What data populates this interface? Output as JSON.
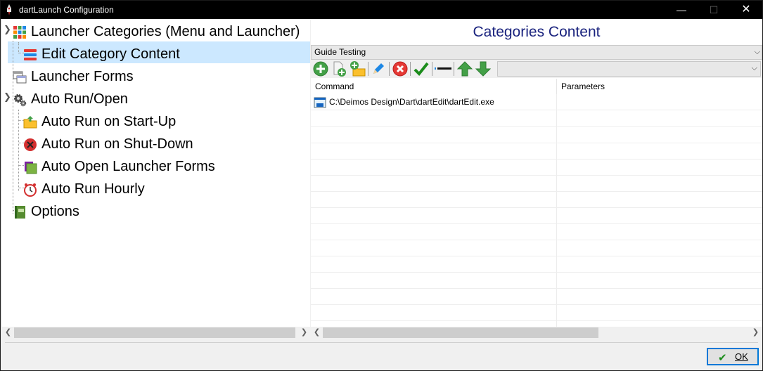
{
  "window": {
    "title": "dartLaunch Configuration",
    "minimize": "—",
    "maximize": "☐",
    "close": "✕"
  },
  "tree": {
    "items": [
      {
        "label": "Launcher Categories (Menu and Launcher)",
        "icon": "grid-icon"
      },
      {
        "label": "Edit Category Content",
        "icon": "list-edit-icon"
      },
      {
        "label": "Launcher Forms",
        "icon": "forms-icon"
      },
      {
        "label": "Auto Run/Open",
        "icon": "gears-icon"
      },
      {
        "label": "Auto Run on Start-Up",
        "icon": "folder-up-icon"
      },
      {
        "label": "Auto Run on Shut-Down",
        "icon": "stop-icon"
      },
      {
        "label": "Auto Open Launcher Forms",
        "icon": "green-folder-icon"
      },
      {
        "label": "Auto Run Hourly",
        "icon": "clock-icon"
      },
      {
        "label": "Options",
        "icon": "options-book-icon"
      }
    ],
    "selected": "Edit Category Content"
  },
  "panel": {
    "heading": "Categories Content",
    "category_select": "Guide Testing",
    "toolbar": {
      "buttons": [
        "add-icon",
        "add-file-icon",
        "add-folder-icon",
        "edit-pencil-icon",
        "delete-icon",
        "check-icon",
        "separator-icon",
        "move-up-icon",
        "move-down-icon"
      ],
      "dropdown_value": ""
    },
    "grid": {
      "columns": [
        "Command",
        "Parameters"
      ],
      "rows": [
        {
          "command": "C:\\Deimos Design\\Dart\\dartEdit\\dartEdit.exe",
          "parameters": ""
        }
      ]
    }
  },
  "footer": {
    "ok_label": "OK"
  },
  "colors": {
    "heading": "#1a237e",
    "selection": "#cce8ff",
    "ok_border": "#0078d7"
  }
}
